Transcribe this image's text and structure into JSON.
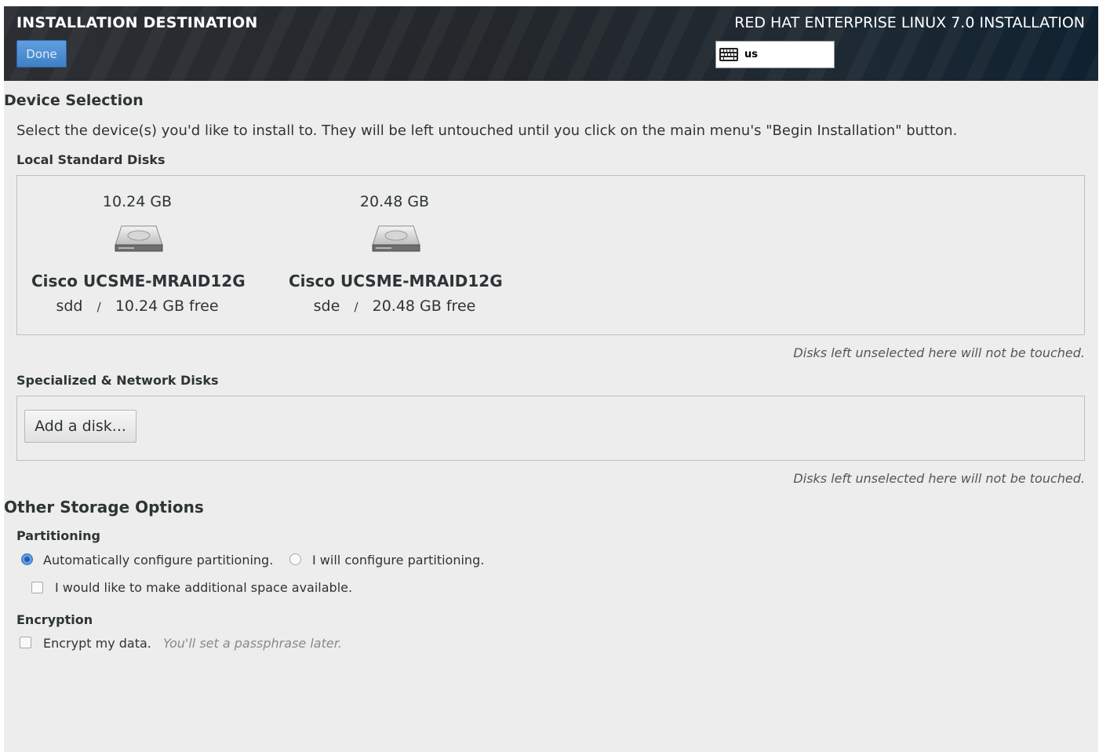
{
  "header": {
    "spoke_title": "INSTALLATION DESTINATION",
    "done_label": "Done",
    "product_title": "RED HAT ENTERPRISE LINUX 7.0 INSTALLATION",
    "keyboard_layout": "us",
    "keyboard_icon": "keyboard-icon"
  },
  "device_selection": {
    "heading": "Device Selection",
    "description": "Select the device(s) you'd like to install to.  They will be left untouched until you click on the main menu's \"Begin Installation\" button.",
    "local_heading": "Local Standard Disks",
    "disks": [
      {
        "size": "10.24 GB",
        "name": "Cisco UCSME-MRAID12G",
        "device": "sdd",
        "sep": "/",
        "free": "10.24 GB free",
        "icon": "hard-disk-icon"
      },
      {
        "size": "20.48 GB",
        "name": "Cisco UCSME-MRAID12G",
        "device": "sde",
        "sep": "/",
        "free": "20.48 GB free",
        "icon": "hard-disk-icon"
      }
    ],
    "local_note": "Disks left unselected here will not be touched.",
    "specialized_heading": "Specialized & Network Disks",
    "add_disk_label": "Add a disk...",
    "specialized_note": "Disks left unselected here will not be touched."
  },
  "other_storage": {
    "heading": "Other Storage Options",
    "partitioning_heading": "Partitioning",
    "auto_label": "Automatically configure partitioning.",
    "auto_selected": true,
    "manual_label": "I will configure partitioning.",
    "manual_selected": false,
    "extra_space_label": "I would like to make additional space available.",
    "extra_space_checked": false,
    "encryption_heading": "Encryption",
    "encrypt_label": "Encrypt my data.",
    "encrypt_checked": false,
    "encrypt_hint": "You'll set a passphrase later."
  },
  "colors": {
    "header_bg": "#23272b",
    "done_button": "#4a89d8",
    "page_bg": "#ededed"
  }
}
